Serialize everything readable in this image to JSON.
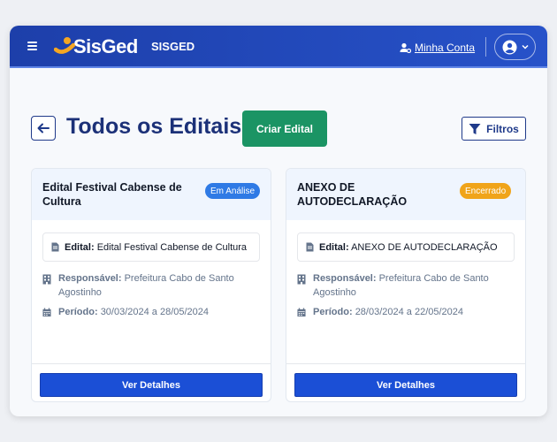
{
  "header": {
    "logo_text": "SisGed",
    "app_name": "SISGED",
    "account_link": "Minha Conta"
  },
  "page": {
    "title": "Todos os Editais",
    "create_button": "Criar Edital",
    "filter_button": "Filtros"
  },
  "labels": {
    "edital": "Edital:",
    "responsavel": "Responsável:",
    "periodo": "Período:",
    "details_button": "Ver Detalhes"
  },
  "cards": [
    {
      "title": "Edital Festival Cabense de Cultura",
      "status": "Em Análise",
      "status_color": "#2f7ae5",
      "edital": "Edital Festival Cabense de Cultura",
      "responsavel": "Prefeitura Cabo de Santo Agostinho",
      "periodo": "30/03/2024 a 28/05/2024"
    },
    {
      "title": "ANEXO DE AUTODECLARAÇÃO",
      "status": "Encerrado",
      "status_color": "#f0a41a",
      "edital": "ANEXO DE AUTODECLARAÇÃO",
      "responsavel": "Prefeitura Cabo de Santo Agostinho",
      "periodo": "28/03/2024 a 22/05/2024"
    }
  ],
  "colors": {
    "header": "#1d3faa",
    "create_button": "#1b9464",
    "details_button": "#1b4fd6",
    "title": "#1c3178"
  },
  "icons": [
    "menu-icon",
    "logo-mark-icon",
    "user-cog-icon",
    "user-circle-icon",
    "chevron-down-icon",
    "arrow-left-icon",
    "filter-icon",
    "document-icon",
    "building-icon",
    "calendar-icon"
  ]
}
